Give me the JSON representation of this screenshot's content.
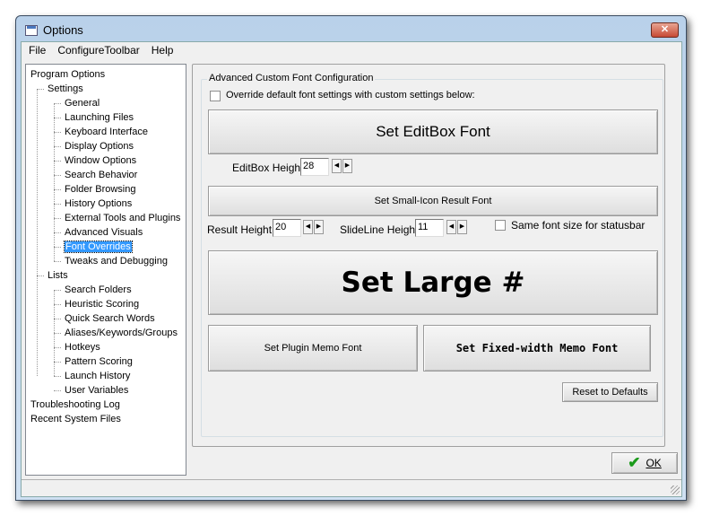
{
  "window": {
    "title": "Options",
    "close_label": "✕"
  },
  "menu": [
    "File",
    "ConfigureToolbar",
    "Help"
  ],
  "tree": [
    {
      "label": "Program Options",
      "level": 0
    },
    {
      "label": "Settings",
      "level": 1
    },
    {
      "label": "General",
      "level": 2
    },
    {
      "label": "Launching Files",
      "level": 2
    },
    {
      "label": "Keyboard Interface",
      "level": 2
    },
    {
      "label": "Display Options",
      "level": 2
    },
    {
      "label": "Window Options",
      "level": 2
    },
    {
      "label": "Search Behavior",
      "level": 2
    },
    {
      "label": "Folder Browsing",
      "level": 2
    },
    {
      "label": "History Options",
      "level": 2
    },
    {
      "label": "External Tools and Plugins",
      "level": 2
    },
    {
      "label": "Advanced Visuals",
      "level": 2
    },
    {
      "label": "Font Overrides",
      "level": 2,
      "selected": true
    },
    {
      "label": "Tweaks and Debugging",
      "level": 2
    },
    {
      "label": "Lists",
      "level": 1
    },
    {
      "label": "Search Folders",
      "level": 2
    },
    {
      "label": "Heuristic Scoring",
      "level": 2
    },
    {
      "label": "Quick Search Words",
      "level": 2
    },
    {
      "label": "Aliases/Keywords/Groups",
      "level": 2
    },
    {
      "label": "Hotkeys",
      "level": 2
    },
    {
      "label": "Pattern Scoring",
      "level": 2
    },
    {
      "label": "Launch History",
      "level": 2
    },
    {
      "label": "User Variables",
      "level": 2
    },
    {
      "label": "Troubleshooting Log",
      "level": 0
    },
    {
      "label": "Recent System Files",
      "level": 0
    }
  ],
  "group": {
    "title": "Advanced Custom Font Configuration",
    "override_label": "Override default font settings with custom settings below:",
    "override_checked": false,
    "editbox_font_button": "Set EditBox Font",
    "editbox_height_label": "EditBox Height:",
    "editbox_height": "28",
    "small_icon_button": "Set Small-Icon Result Font",
    "result_height_label": "Result Height:",
    "result_height": "20",
    "slideline_height_label": "SlideLine Height:",
    "slideline_height": "11",
    "statusbar_label": "Same font size for statusbar",
    "statusbar_checked": false,
    "large_button": "Set Large #",
    "plugin_memo_button": "Set Plugin Memo Font",
    "fixed_memo_button": "Set Fixed-width Memo Font",
    "reset_button": "Reset to Defaults"
  },
  "ok_button": "OK",
  "colors": {
    "selection": "#3399ff",
    "ok_check": "#1a9a1a"
  }
}
